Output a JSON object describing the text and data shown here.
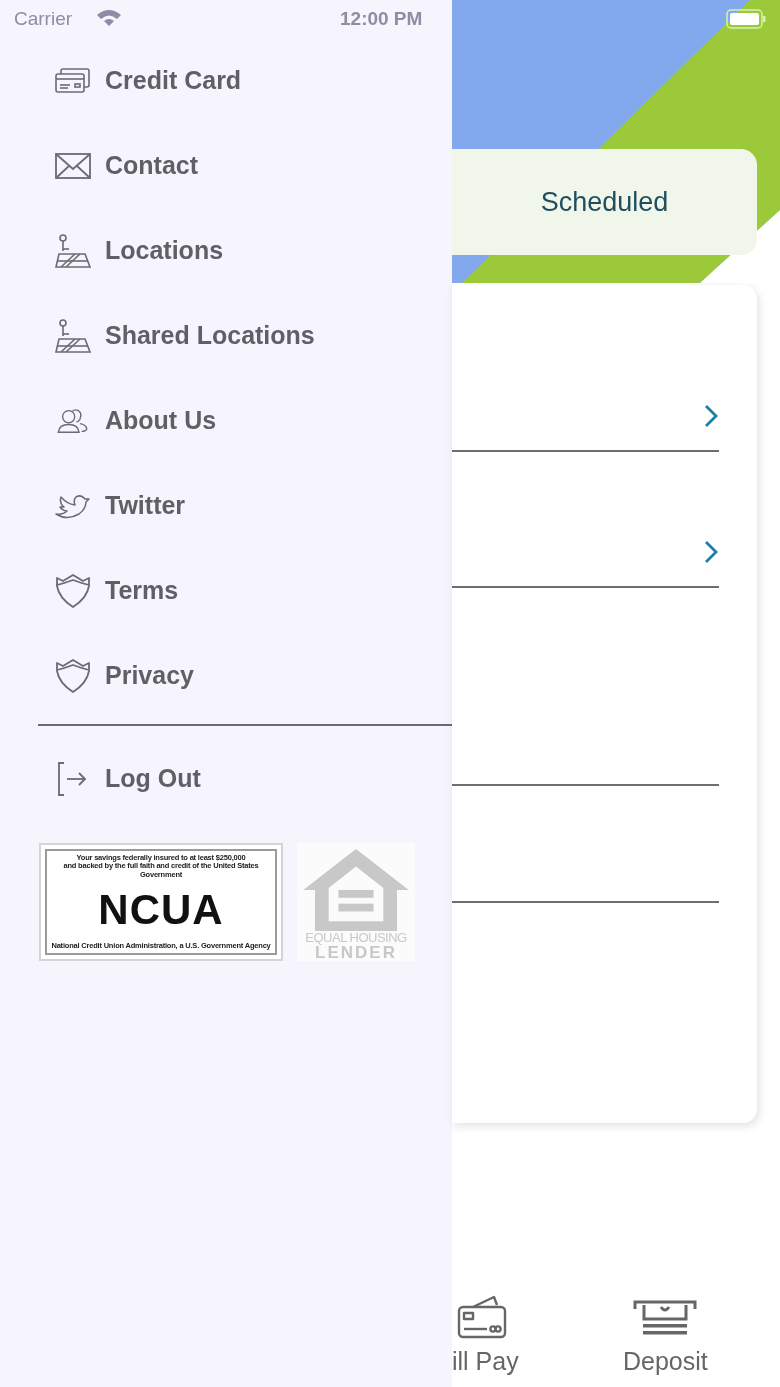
{
  "status_bar": {
    "carrier": "Carrier",
    "time": "12:00 PM"
  },
  "menu": [
    {
      "label": "Credit Card",
      "kind": "cards"
    },
    {
      "label": "Contact",
      "kind": "mail"
    },
    {
      "label": "Locations",
      "kind": "map"
    },
    {
      "label": "Shared Locations",
      "kind": "map"
    },
    {
      "label": "About Us",
      "kind": "people"
    },
    {
      "label": "Twitter",
      "kind": "bird"
    },
    {
      "label": "Terms",
      "kind": "shield"
    },
    {
      "label": "Privacy",
      "kind": "shield"
    }
  ],
  "logout": {
    "label": "Log Out"
  },
  "ncua_badge": {
    "line_1": "Your savings federally insured to at least $250,000",
    "line_2": "and backed by the full faith and credit of the United States Government",
    "title": "NCUA",
    "footer": "National Credit Union Administration, a U.S. Government Agency"
  },
  "equal_housing_badge": {
    "line_1": "EQUAL HOUSING",
    "line_2": "LENDER"
  },
  "schedule_card": {
    "label": "Scheduled"
  },
  "list_rows": [
    {
      "kind": "link"
    },
    {
      "kind": "link"
    },
    {
      "kind": "plain"
    },
    {
      "kind": "plain"
    }
  ],
  "bottom_tabs": [
    {
      "label": "ill Pay",
      "kind": "bill"
    },
    {
      "label": "Deposit",
      "kind": "deposit"
    }
  ]
}
